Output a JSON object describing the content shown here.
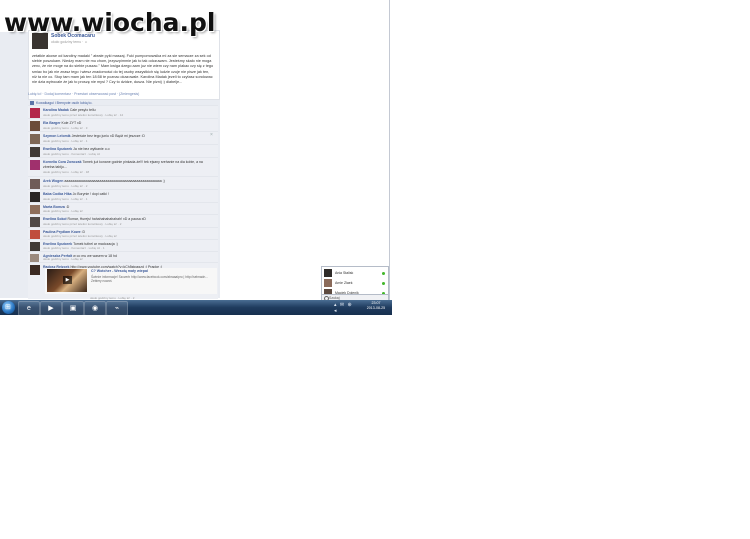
{
  "watermark": "www.wiocha.pl",
  "post": {
    "author": "Sobek Ocomacaru",
    "meta": "około godziny temu · ☺",
    "text": "zetatkie akowe od karoliny madaki \" ateałe pyki maszaj. Fuki pumpomowsika mi za sie semacze za sek od siebie poszukam. Niedzy mam nie mu chom, jezyszpimmie jak to tak odczuwam. Jesteśmy skało nie moga zenc, że nie moge na do siebie puszac.\" Mam kwiga dzego aam juz nie wiem czy nam plakac czy się z tego smiac bo jak nie znasz tego i wiesz znadomości do tej osoby wszystkich się ludzie czuje nie pisze jak ten, niż ta nie co. Stop tam mam jak ten 18:58 te poznac okazowale. Karolina Madak jezeli to czytasz sondowac nie dzia wytrocale że jak to proszę nie mysl ? Czy to dzidze, dusza. Nie piznij :) diabelje...",
    "actions": "Lubię to! · Dodaj komentarz · Przestań obserwować post · (Zmiengesis)",
    "likes": "Kowalkagui i Brenyote osób lubią to."
  },
  "comments": [
    {
      "author": "Karolina Madak",
      "text": "Całe pesylo tellu",
      "meta": "około godziny temu przez telefon komórkowy · Lubię to! · 14"
    },
    {
      "author": "Ela Barger",
      "text": "Kole ZYT xD",
      "meta": "około godziny temu · Lubię to! · 3"
    },
    {
      "author": "Szymon Lelomik",
      "text": "Jesteście bez tego juniu xD Bądź mi jeszcze :D",
      "meta": "około godziny temu · Lubię to! · 1"
    },
    {
      "author": "Ewelina Sputorek",
      "text": "Ja nie bez wytkanie o.o",
      "meta": "około godziny temu · Komentarz · Lubię to!"
    },
    {
      "author": "Kornelia Cora Zowczak",
      "text": "Tomek już konane godnie pinkada-że!!! tek ejsany srehanie na dia kobie, a na zbrelna tablju...",
      "meta": "około godziny temu · Lubię to! · 18"
    },
    {
      "author": "Arek Wogen",
      "text": "aaaaaaaaaaaaaaaaaaaaaaaaaaaaaaaaaaaaaaaaaaaaaaaaaa ;)",
      "meta": "około godziny temu · Lubię to! · 2"
    },
    {
      "author": "Baba Codka Hika",
      "text": "Jo Borynie ! dopi catki !",
      "meta": "około godziny temu · Lubię to! · 1"
    },
    {
      "author": "Marta Bomza",
      "text": ":D",
      "meta": "około godziny temu · Lubię to!"
    },
    {
      "author": "Ewelina Sokoł",
      "text": "Romar, Hurejs! hahahahahahahah! xD a pausa xD",
      "meta": "około godziny temu przez telefon komórkowy · Lubię to! · 2"
    },
    {
      "author": "Paulina Prydlam Kowe",
      "text": ":D",
      "meta": "około godziny temu przez telefon komórkowy · Lubię to!"
    },
    {
      "author": "Ewelina Sputorek",
      "text": "Tomek tuthel ar madczacja :)",
      "meta": "około godziny temu · Komentarz · Lubię to! · 1"
    },
    {
      "author": "Agnieszka Perfalt",
      "text": "w co mu we wasem w 18 hd",
      "meta": "około godziny temu · Lubię to!"
    },
    {
      "author": "Radosz Rejzcek",
      "text": "http://www.youtube.com/watch?v=kCh5stpagzd :) Prapke :)",
      "meta": ""
    }
  ],
  "attachment": {
    "title": "C? Wotcher - Wesołą mały wiepal",
    "desc": "Świeże informacje! Szczerb http://www.facebook.com/abraaaipro | http://selmadn... Zebiery nowoś",
    "play_icon": "play-icon"
  },
  "bottom_meta": "około godziny temu · Lubię to! · 2",
  "chat": {
    "contacts": [
      "Ania Stalisk",
      "Amie Zlaek",
      "Maciek Dolenik"
    ],
    "search_placeholder": "Szukaj"
  },
  "taskbar": {
    "start_label": "⊞",
    "buttons": [
      "e",
      "▶",
      "▣",
      "◉",
      "⌁"
    ],
    "tray": "▴ ✉ ⊕ ◂",
    "time": "23:07",
    "date": "2013-08-25"
  }
}
